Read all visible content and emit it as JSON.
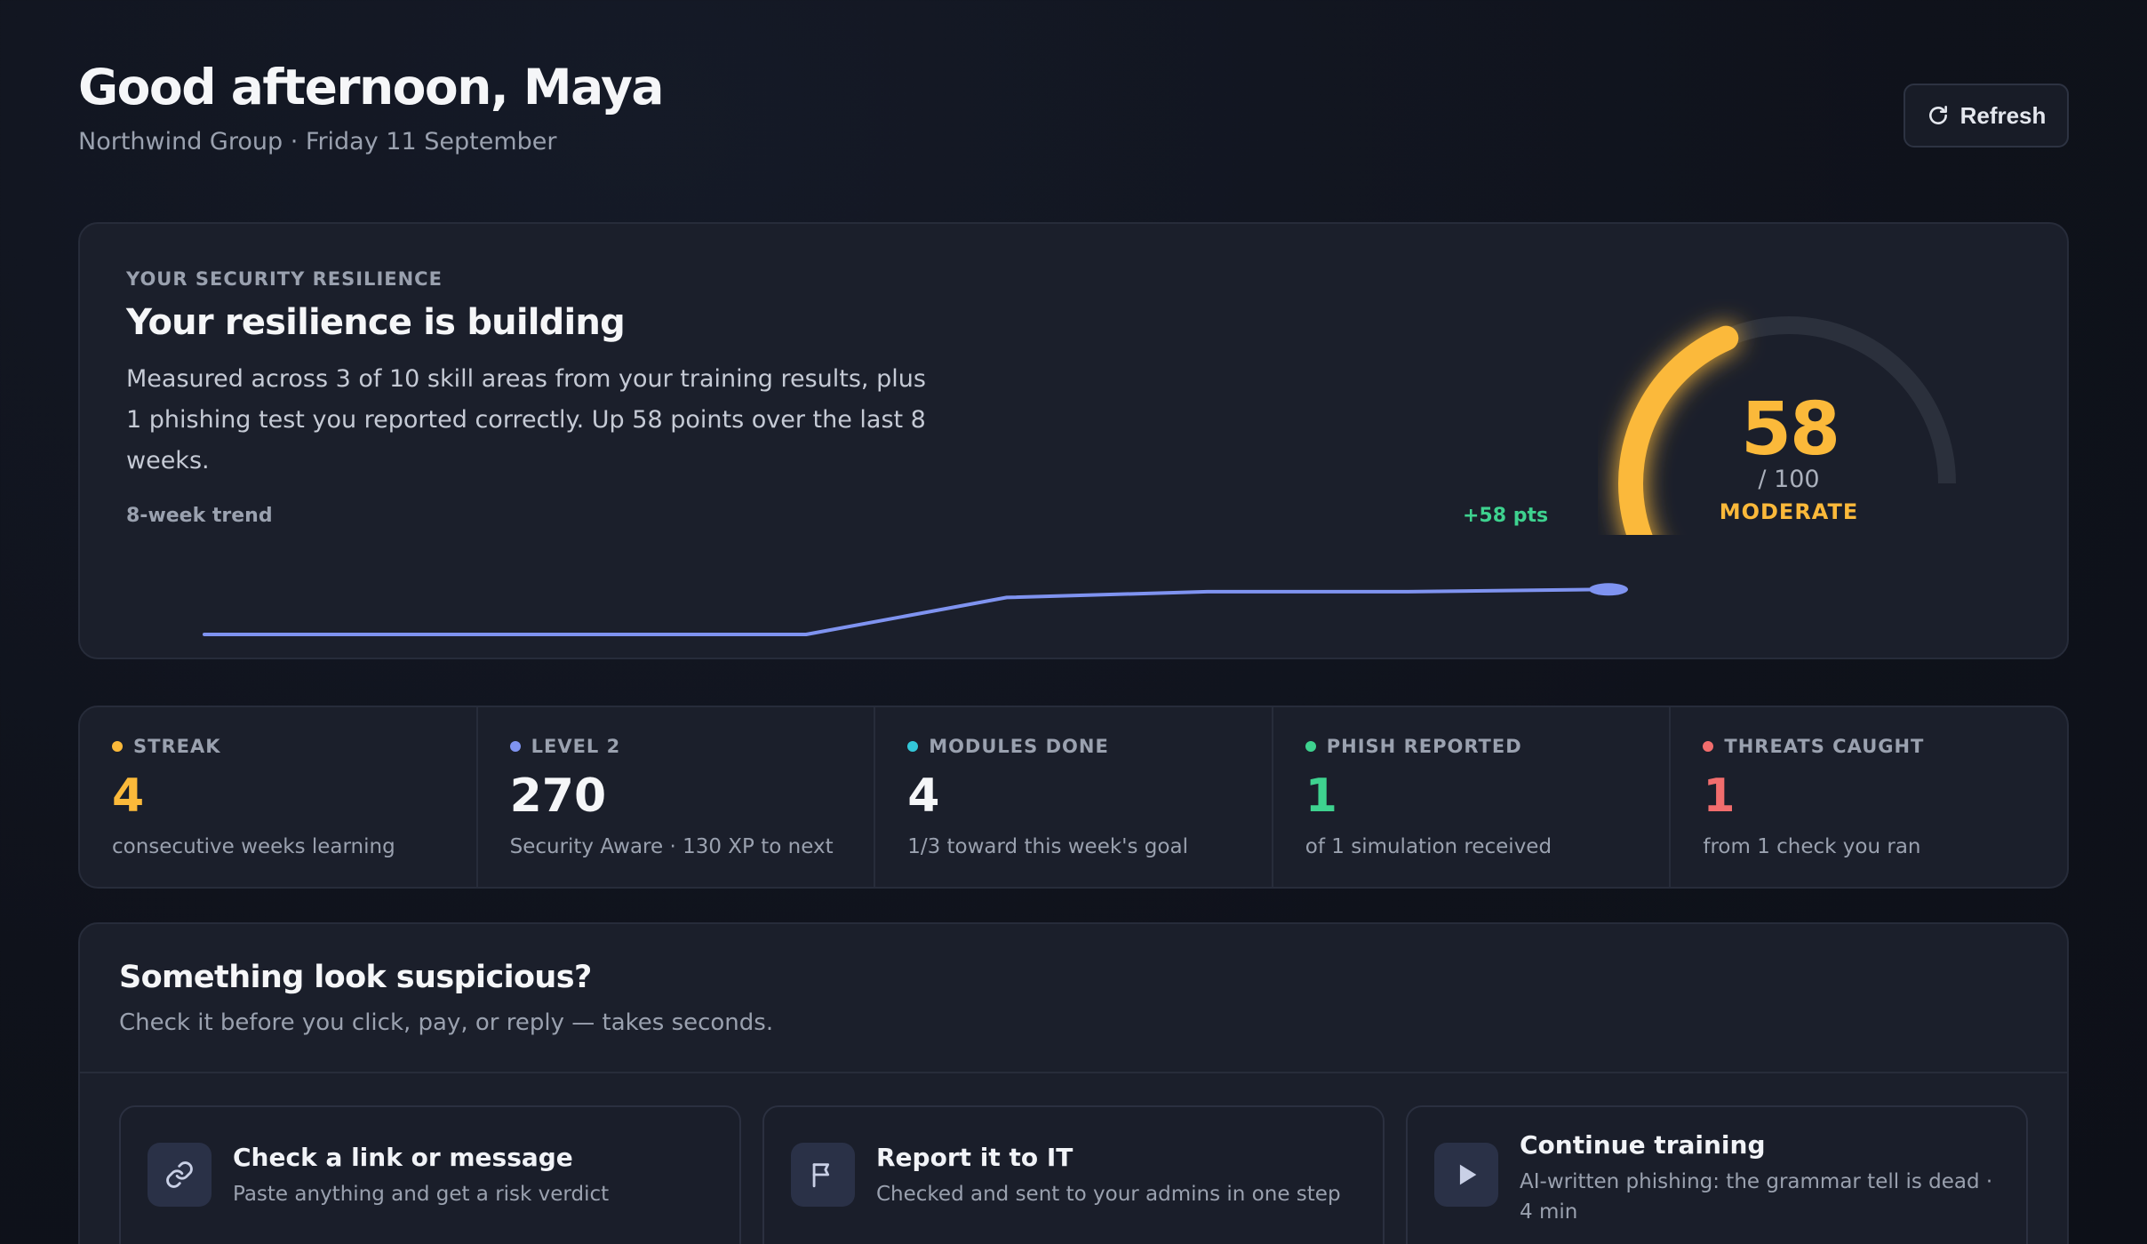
{
  "header": {
    "greeting": "Good afternoon, Maya",
    "subline": "Northwind Group · Friday 11 September",
    "refresh_label": "Refresh"
  },
  "resilience": {
    "eyebrow": "YOUR SECURITY RESILIENCE",
    "title": "Your resilience is building",
    "description": "Measured across 3 of 10 skill areas from your training results, plus 1 phishing test you reported correctly. Up 58 points over the last 8 weeks.",
    "trend_label": "8-week trend",
    "trend_delta": "+58 pts",
    "trend_values": [
      0,
      0,
      0,
      0,
      32,
      37,
      37,
      39
    ],
    "score": "58",
    "score_value": 58,
    "score_max": "/ 100",
    "band": "MODERATE",
    "accent_color": "#fbb93a",
    "trend_color": "#7f93f0"
  },
  "stats": [
    {
      "label": "STREAK",
      "value": "4",
      "note": "consecutive weeks learning",
      "color": "#fbb93a"
    },
    {
      "label": "LEVEL 2",
      "value": "270",
      "note": "Security Aware · 130 XP to next",
      "color": "#7f93f0",
      "value_color": "#f5f6f8"
    },
    {
      "label": "MODULES DONE",
      "value": "4",
      "note": "1/3 toward this week's goal",
      "color": "#33c7d8",
      "value_color": "#f5f6f8"
    },
    {
      "label": "PHISH REPORTED",
      "value": "1",
      "note": "of 1 simulation received",
      "color": "#3ed28f"
    },
    {
      "label": "THREATS CAUGHT",
      "value": "1",
      "note": "from 1 check you ran",
      "color": "#f26d6d"
    }
  ],
  "suspicious": {
    "title": "Something look suspicious?",
    "subtitle": "Check it before you click, pay, or reply — takes seconds.",
    "actions": [
      {
        "title": "Check a link or message",
        "desc": "Paste anything and get a risk verdict",
        "icon": "link-icon"
      },
      {
        "title": "Report it to IT",
        "desc": "Checked and sent to your admins in one step",
        "icon": "flag-icon"
      },
      {
        "title": "Continue training",
        "desc": "AI-written phishing: the grammar tell is dead · 4 min",
        "icon": "play-icon"
      }
    ]
  }
}
